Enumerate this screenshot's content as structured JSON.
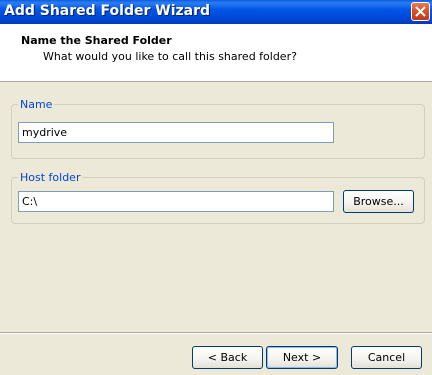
{
  "window": {
    "title": "Add Shared Folder Wizard",
    "close_icon": "close-icon"
  },
  "header": {
    "title": "Name the Shared Folder",
    "subtitle": "What would you like to call this shared folder?"
  },
  "name_group": {
    "label": "Name",
    "value": "mydrive"
  },
  "host_group": {
    "label": "Host folder",
    "value": "C:\\",
    "browse_label": "Browse..."
  },
  "footer": {
    "back_label": "< Back",
    "next_label": "Next >",
    "cancel_label": "Cancel"
  },
  "colors": {
    "title_bar": "#0055e5",
    "group_label": "#0046d5",
    "dialog_bg": "#ece9d8"
  }
}
